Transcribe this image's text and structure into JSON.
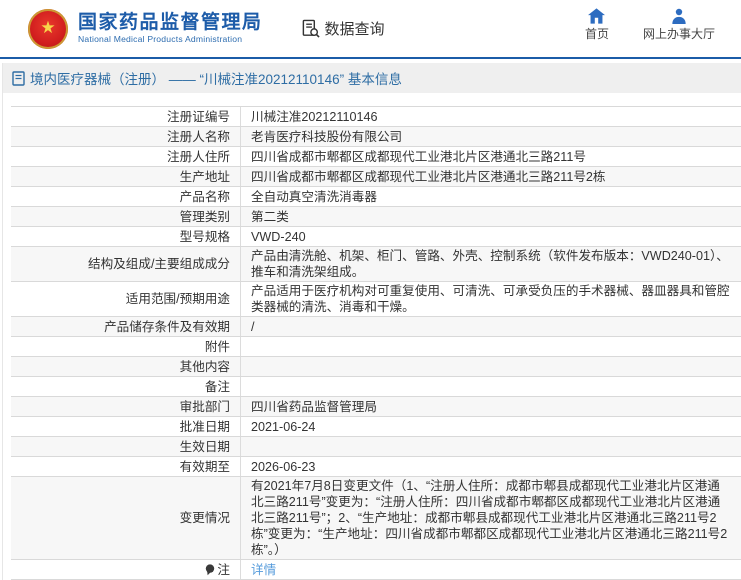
{
  "header": {
    "logo": {
      "title": "国家药品监督管理局",
      "subtitle": "National Medical Products Administration"
    },
    "nav": {
      "data_query": "数据查询",
      "home": "首页",
      "service_hall": "网上办事大厅"
    }
  },
  "titlebar": {
    "title": "境内医疗器械（注册） —— “川械注准20212110146” 基本信息"
  },
  "table": {
    "rows": [
      {
        "label": "注册证编号",
        "value": "川械注准20212110146"
      },
      {
        "label": "注册人名称",
        "value": "老肯医疗科技股份有限公司"
      },
      {
        "label": "注册人住所",
        "value": "四川省成都市郫都区成都现代工业港北片区港通北三路211号"
      },
      {
        "label": "生产地址",
        "value": "四川省成都市郫都区成都现代工业港北片区港通北三路211号2栋"
      },
      {
        "label": "产品名称",
        "value": "全自动真空清洗消毒器"
      },
      {
        "label": "管理类别",
        "value": "第二类"
      },
      {
        "label": "型号规格",
        "value": "VWD-240"
      },
      {
        "label": "结构及组成/主要组成成分",
        "value": "产品由清洗舱、机架、柜门、管路、外壳、控制系统（软件发布版本：VWD240-01）、推车和清洗架组成。"
      },
      {
        "label": "适用范围/预期用途",
        "value": "产品适用于医疗机构对可重复使用、可清洗、可承受负压的手术器械、器皿器具和管腔类器械的清洗、消毒和干燥。"
      },
      {
        "label": "产品储存条件及有效期",
        "value": "/"
      },
      {
        "label": "附件",
        "value": ""
      },
      {
        "label": "其他内容",
        "value": ""
      },
      {
        "label": "备注",
        "value": ""
      },
      {
        "label": "审批部门",
        "value": "四川省药品监督管理局"
      },
      {
        "label": "批准日期",
        "value": "2021-06-24"
      },
      {
        "label": "生效日期",
        "value": ""
      },
      {
        "label": "有效期至",
        "value": "2026-06-23"
      },
      {
        "label": "变更情况",
        "value": "有2021年7月8日变更文件（1、“注册人住所：成都市郫县成都现代工业港北片区港通北三路211号”变更为：“注册人住所：四川省成都市郫都区成都现代工业港北片区港通北三路211号”；2、“生产地址：成都市郫县成都现代工业港北片区港通北三路211号2栋”变更为：“生产地址：四川省成都市郫都区成都现代工业港北片区港通北三路211号2栋”。）"
      },
      {
        "label": "注",
        "value": "详情"
      }
    ]
  },
  "colors": {
    "accent_blue": "#1b5ca8",
    "titlebar_text": "#2e6da4",
    "link_blue": "#559bdb",
    "alt_row_bg": "#f7f7f7",
    "emblem_red": "#d21f1f"
  }
}
